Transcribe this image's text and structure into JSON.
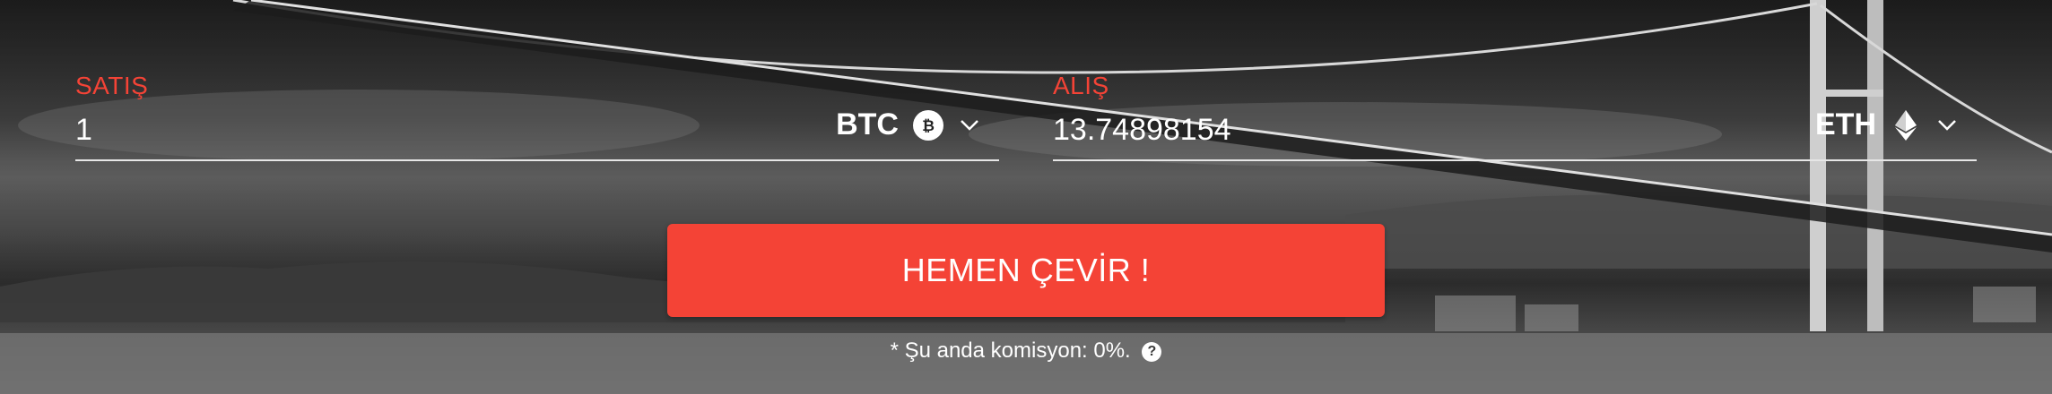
{
  "colors": {
    "accent": "#f44336",
    "label": "#f44336",
    "text": "#ffffff",
    "underline": "#e6e6e6"
  },
  "sell": {
    "label": "SATIŞ",
    "value": "1",
    "currency": "BTC",
    "currency_icon": "bitcoin-icon",
    "dropdown_icon": "chevron-down-icon"
  },
  "buy": {
    "label": "ALIŞ",
    "value": "13.74898154",
    "currency": "ETH",
    "currency_icon": "ethereum-icon",
    "dropdown_icon": "chevron-down-icon"
  },
  "convert_button": {
    "label": "HEMEN ÇEVİR !"
  },
  "commission": {
    "text": "* Şu anda komisyon: 0%.",
    "help_icon": "question-circle-icon",
    "help_glyph": "?"
  }
}
